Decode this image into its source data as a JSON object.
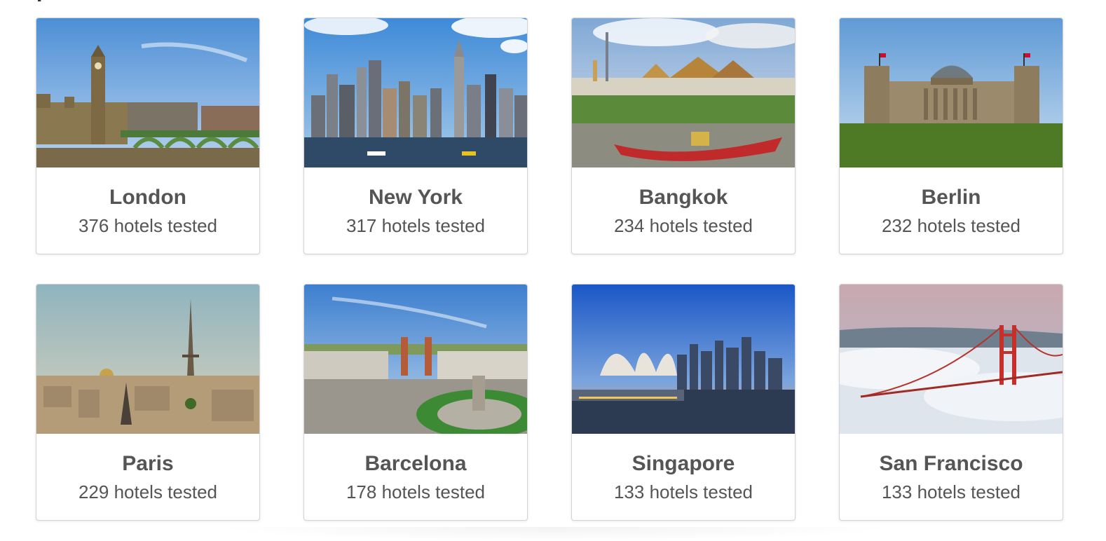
{
  "heading_fragment": "P",
  "cards": [
    {
      "city": "London",
      "count": "376 hotels tested",
      "photo_icon": "london-skyline-photo",
      "colors": {
        "sky_top": "#4d8fd6",
        "sky_bottom": "#b9d3ee",
        "ground": "#7a6a4a"
      }
    },
    {
      "city": "New York",
      "count": "317 hotels tested",
      "photo_icon": "new-york-skyline-photo",
      "colors": {
        "sky_top": "#3e8ad8",
        "sky_bottom": "#a9cbe9",
        "ground": "#2f4a66"
      }
    },
    {
      "city": "Bangkok",
      "count": "234 hotels tested",
      "photo_icon": "bangkok-temple-photo",
      "colors": {
        "sky_top": "#7fa8d6",
        "sky_bottom": "#e3e7ee",
        "ground": "#8d8c80"
      }
    },
    {
      "city": "Berlin",
      "count": "232 hotels tested",
      "photo_icon": "berlin-reichstag-photo",
      "colors": {
        "sky_top": "#5f9ad6",
        "sky_bottom": "#c9ddef",
        "ground": "#4f7a25"
      }
    },
    {
      "city": "Paris",
      "count": "229 hotels tested",
      "photo_icon": "paris-eiffel-tower-photo",
      "colors": {
        "sky_top": "#8fb4bf",
        "sky_bottom": "#d9d2bb",
        "ground": "#b59c78"
      }
    },
    {
      "city": "Barcelona",
      "count": "178 hotels tested",
      "photo_icon": "barcelona-plaza-photo",
      "colors": {
        "sky_top": "#3d7fcf",
        "sky_bottom": "#bcd5ec",
        "ground": "#9a968e"
      }
    },
    {
      "city": "Singapore",
      "count": "133 hotels tested",
      "photo_icon": "singapore-marina-photo",
      "colors": {
        "sky_top": "#1a57c7",
        "sky_bottom": "#e9a47a",
        "ground": "#2c3a52"
      }
    },
    {
      "city": "San Francisco",
      "count": "133 hotels tested",
      "photo_icon": "golden-gate-bridge-photo",
      "colors": {
        "sky_top": "#c9a8b0",
        "sky_bottom": "#aebccb",
        "ground": "#dfe5ec"
      }
    }
  ]
}
